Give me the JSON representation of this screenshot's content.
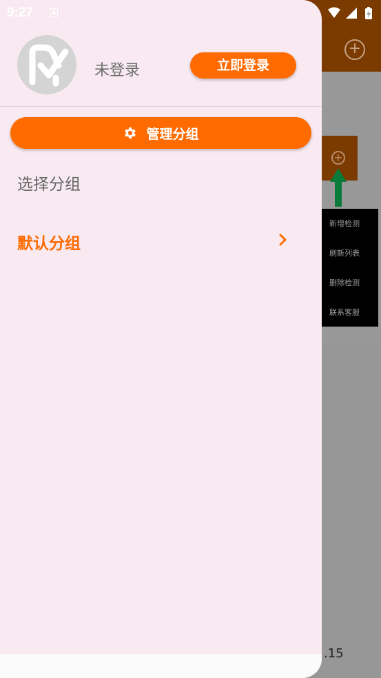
{
  "status_bar": {
    "time": "9:27",
    "notification_icon": "A"
  },
  "background_app": {
    "add_icon": "plus-circle-icon",
    "popup_menu": [
      "新增检测",
      "刷新列表",
      "删除检测",
      "联系客服"
    ],
    "version_fragment": ".15",
    "accent_color": "#7a3a00"
  },
  "drawer": {
    "account": {
      "status": "未登录",
      "login_button": "立即登录"
    },
    "manage_button": {
      "icon": "gear-icon",
      "label": "管理分组"
    },
    "section_title": "选择分组",
    "groups": [
      {
        "name": "默认分组"
      }
    ],
    "accent_color": "#ff6b00",
    "background_color": "#f9eaf2"
  }
}
